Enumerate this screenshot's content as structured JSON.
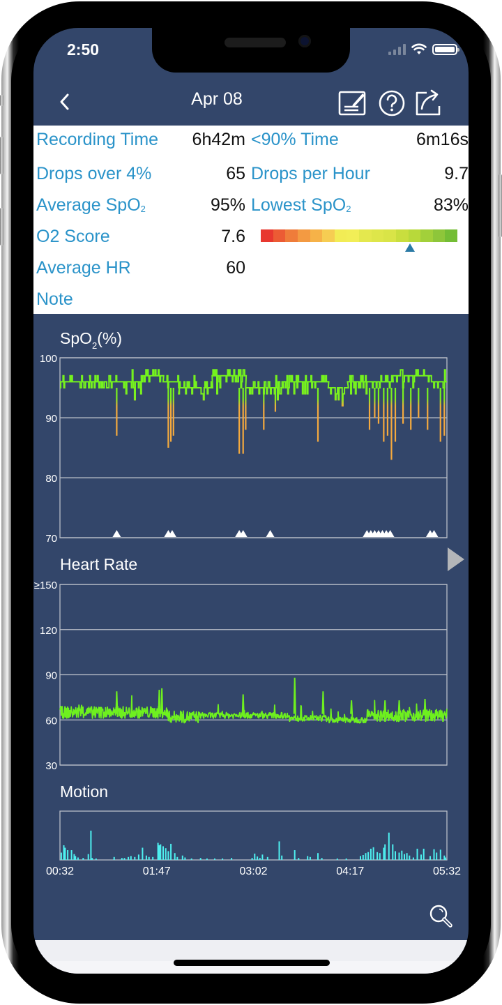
{
  "status_bar": {
    "time": "2:50"
  },
  "header": {
    "title": "Apr 08",
    "back_icon": "chevron-left-icon",
    "actions": [
      {
        "name": "edit-note-button",
        "icon": "edit-note-icon"
      },
      {
        "name": "help-button",
        "icon": "question-circle-icon"
      },
      {
        "name": "share-button",
        "icon": "share-icon"
      }
    ]
  },
  "summary": {
    "recording_time": {
      "label": "Recording Time",
      "value": "6h42m"
    },
    "below90_time": {
      "label": "<90% Time",
      "value": "6m16s"
    },
    "drops_over_4": {
      "label": "Drops over 4%",
      "value": "65"
    },
    "drops_per_hour": {
      "label": "Drops per Hour",
      "value": "9.7"
    },
    "average_spo2": {
      "label": "Average SpO",
      "sub": "2",
      "value": "95%"
    },
    "lowest_spo2": {
      "label": "Lowest SpO",
      "sub": "2",
      "value": "83%"
    },
    "o2_score": {
      "label": "O2 Score",
      "value": "7.6"
    },
    "average_hr": {
      "label": "Average HR",
      "value": "60"
    },
    "note": {
      "label": "Note"
    },
    "score_scale": {
      "min": 0,
      "max": 10,
      "marker_value": 7.6,
      "segments": [
        "#e8382f",
        "#ec5b34",
        "#ef7c3a",
        "#f39a42",
        "#f6b248",
        "#f6cd52",
        "#f2ec55",
        "#f2ee57",
        "#e4e84e",
        "#dee64a",
        "#d9e447",
        "#c9de3e",
        "#b8d93a",
        "#a2d03a",
        "#8ec63a",
        "#74bd35"
      ]
    }
  },
  "charts": {
    "spo2_title": "SpO",
    "spo2_title_sub": "2",
    "spo2_title_suffix": "(%)",
    "hr_title": "Heart Rate",
    "motion_title": "Motion",
    "next_icon": "play-right-icon",
    "zoom_icon": "magnifier-icon"
  },
  "chart_data": [
    {
      "type": "line",
      "title": "SpO2(%)",
      "ylim": [
        70,
        100
      ],
      "yticks": [
        "100",
        "90",
        "80",
        "70"
      ],
      "ytick_values": [
        100,
        90,
        80,
        70
      ],
      "xlim": [
        "00:32",
        "05:32"
      ],
      "xlim_minutes": [
        32,
        332
      ],
      "grid": true,
      "series": [
        {
          "name": "SpO2",
          "baseline_segments": [
            {
              "from": 32,
              "to": 55,
              "value": 96
            },
            {
              "from": 55,
              "to": 95,
              "value": 96
            },
            {
              "from": 95,
              "to": 112,
              "value": 97
            },
            {
              "from": 112,
              "to": 124,
              "value": 96
            },
            {
              "from": 124,
              "to": 150,
              "value": 95
            },
            {
              "from": 150,
              "to": 176,
              "value": 97
            },
            {
              "from": 176,
              "to": 205,
              "value": 95
            },
            {
              "from": 205,
              "to": 240,
              "value": 96
            },
            {
              "from": 240,
              "to": 255,
              "value": 95
            },
            {
              "from": 255,
              "to": 290,
              "value": 96
            },
            {
              "from": 290,
              "to": 320,
              "value": 97
            },
            {
              "from": 320,
              "to": 332,
              "value": 96
            }
          ],
          "dips": [
            {
              "t": 76,
              "min": 87
            },
            {
              "t": 116,
              "min": 85
            },
            {
              "t": 118,
              "min": 86
            },
            {
              "t": 120,
              "min": 87
            },
            {
              "t": 171,
              "min": 84
            },
            {
              "t": 174,
              "min": 84
            },
            {
              "t": 176,
              "min": 88
            },
            {
              "t": 190,
              "min": 88
            },
            {
              "t": 199,
              "min": 91
            },
            {
              "t": 232,
              "min": 86
            },
            {
              "t": 272,
              "min": 88
            },
            {
              "t": 276,
              "min": 90
            },
            {
              "t": 279,
              "min": 89
            },
            {
              "t": 283,
              "min": 86
            },
            {
              "t": 286,
              "min": 87
            },
            {
              "t": 289,
              "min": 83
            },
            {
              "t": 292,
              "min": 86
            },
            {
              "t": 298,
              "min": 89
            },
            {
              "t": 304,
              "min": 88
            },
            {
              "t": 310,
              "min": 90
            },
            {
              "t": 317,
              "min": 88
            },
            {
              "t": 327,
              "min": 86
            },
            {
              "t": 330,
              "min": 87
            }
          ]
        }
      ],
      "drop_markers_minutes": [
        76,
        116,
        119,
        171,
        174,
        195,
        270,
        273,
        276,
        279,
        282,
        285,
        288,
        319,
        322
      ]
    },
    {
      "type": "line",
      "title": "Heart Rate",
      "ylim": [
        30,
        150
      ],
      "yticks": [
        "≥150",
        "120",
        "90",
        "60",
        "30"
      ],
      "ytick_values": [
        150,
        120,
        90,
        60,
        30
      ],
      "xlim_minutes": [
        32,
        332
      ],
      "grid": true,
      "series": [
        {
          "name": "Heart Rate",
          "segments": [
            {
              "from": 32,
              "to": 115,
              "mean": 65,
              "noise": 4
            },
            {
              "from": 115,
              "to": 140,
              "mean": 62,
              "noise": 4
            },
            {
              "from": 140,
              "to": 210,
              "mean": 63,
              "noise": 2
            },
            {
              "from": 210,
              "to": 240,
              "mean": 61,
              "noise": 2
            },
            {
              "from": 240,
              "to": 270,
              "mean": 60,
              "noise": 2
            },
            {
              "from": 270,
              "to": 332,
              "mean": 63,
              "noise": 4
            }
          ],
          "spikes": [
            {
              "t": 76,
              "v": 79
            },
            {
              "t": 109,
              "v": 80
            },
            {
              "t": 111,
              "v": 81
            },
            {
              "t": 174,
              "v": 77
            },
            {
              "t": 214,
              "v": 88
            },
            {
              "t": 236,
              "v": 79
            },
            {
              "t": 258,
              "v": 73
            },
            {
              "t": 284,
              "v": 73
            },
            {
              "t": 295,
              "v": 73
            },
            {
              "t": 315,
              "v": 74
            }
          ]
        }
      ]
    },
    {
      "type": "bar",
      "title": "Motion",
      "ylim": [
        0,
        10
      ],
      "xlim_minutes": [
        32,
        332
      ],
      "xticks": [
        "00:32",
        "01:47",
        "03:02",
        "04:17",
        "05:32"
      ],
      "xtick_minutes": [
        32,
        107,
        182,
        257,
        332
      ],
      "series": [
        {
          "name": "Motion",
          "points": [
            [
              33,
              1.5
            ],
            [
              35,
              3
            ],
            [
              36,
              2.5
            ],
            [
              38,
              2
            ],
            [
              41,
              2
            ],
            [
              43,
              1.2
            ],
            [
              44,
              0.8
            ],
            [
              46,
              0.5
            ],
            [
              50,
              0.4
            ],
            [
              54,
              1.2
            ],
            [
              56,
              6
            ],
            [
              57,
              0.4
            ],
            [
              60,
              0.3
            ],
            [
              74,
              0.6
            ],
            [
              80,
              0.4
            ],
            [
              82,
              0.4
            ],
            [
              85,
              0.6
            ],
            [
              87,
              0.8
            ],
            [
              90,
              0.6
            ],
            [
              93,
              1.1
            ],
            [
              96,
              2.5
            ],
            [
              99,
              0.9
            ],
            [
              101,
              0.6
            ],
            [
              104,
              0.6
            ],
            [
              108,
              3.5
            ],
            [
              109,
              3
            ],
            [
              110,
              3.2
            ],
            [
              112,
              2.8
            ],
            [
              114,
              2.4
            ],
            [
              116,
              1.8
            ],
            [
              118,
              3.3
            ],
            [
              121,
              1.4
            ],
            [
              123,
              0.6
            ],
            [
              127,
              0.9
            ],
            [
              129,
              0.5
            ],
            [
              134,
              0.3
            ],
            [
              141,
              0.4
            ],
            [
              146,
              0.3
            ],
            [
              152,
              0.3
            ],
            [
              158,
              0.3
            ],
            [
              165,
              0.4
            ],
            [
              181,
              0.4
            ],
            [
              183,
              1.3
            ],
            [
              185,
              0.7
            ],
            [
              187,
              0.4
            ],
            [
              189,
              1.1
            ],
            [
              193,
              0.6
            ],
            [
              202,
              3.8
            ],
            [
              204,
              0.9
            ],
            [
              214,
              2
            ],
            [
              217,
              0.4
            ],
            [
              224,
              0.8
            ],
            [
              226,
              0.6
            ],
            [
              232,
              1.4
            ],
            [
              235,
              0.4
            ],
            [
              247,
              0.3
            ],
            [
              254,
              0.3
            ],
            [
              265,
              0.8
            ],
            [
              267,
              1
            ],
            [
              269,
              1.4
            ],
            [
              271,
              1.6
            ],
            [
              273,
              2.3
            ],
            [
              275,
              2.6
            ],
            [
              278,
              1.6
            ],
            [
              280,
              1.4
            ],
            [
              283,
              2.5
            ],
            [
              284,
              3.2
            ],
            [
              287,
              5.6
            ],
            [
              290,
              3.2
            ],
            [
              292,
              1.8
            ],
            [
              295,
              1.5
            ],
            [
              297,
              1.9
            ],
            [
              299,
              1.2
            ],
            [
              301,
              1.4
            ],
            [
              303,
              0.9
            ],
            [
              306,
              0.5
            ],
            [
              309,
              2.3
            ],
            [
              312,
              1.1
            ],
            [
              314,
              2.3
            ],
            [
              319,
              0.8
            ],
            [
              322,
              2.2
            ],
            [
              324,
              1.5
            ],
            [
              327,
              2.1
            ],
            [
              330,
              0.9
            ],
            [
              331,
              0.5
            ]
          ]
        }
      ]
    }
  ]
}
